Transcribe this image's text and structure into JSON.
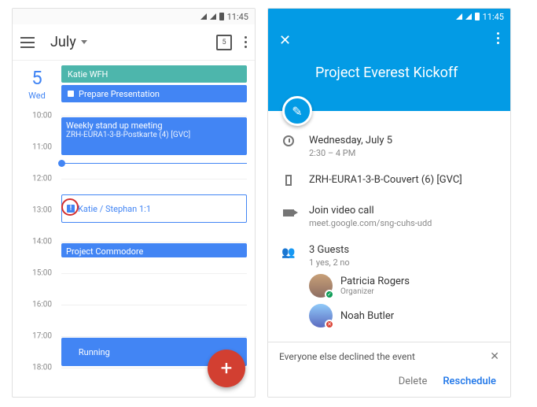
{
  "statusbar": {
    "time": "11:45"
  },
  "calendar": {
    "month": "July",
    "today_icon_num": "5",
    "day": {
      "num": "5",
      "name": "Wed"
    },
    "allday": [
      {
        "label": "Katie WFH",
        "color": "teal"
      },
      {
        "label": "Prepare Presentation",
        "color": "blue"
      }
    ],
    "hours": [
      "10:00",
      "11:00",
      "12:00",
      "13:00",
      "14:00",
      "15:00",
      "16:00",
      "17:00",
      "18:00"
    ],
    "events": {
      "standup_title": "Weekly stand up meeting",
      "standup_loc": "ZRH-EURA1-3-B-Postkarte (4) [GVC]",
      "one_on_one": "Katie / Stephan 1:1",
      "commodore": "Project Commodore",
      "running": "Running"
    }
  },
  "event_detail": {
    "title": "Project Everest Kickoff",
    "date": "Wednesday, July 5",
    "time": "2:30 – 4 PM",
    "room": "ZRH-EURA1-3-B-Couvert (6) [GVC]",
    "video_label": "Join video call",
    "video_url": "meet.google.com/sng-cuhs-udd",
    "guests_count": "3 Guests",
    "guests_status": "1 yes, 2 no",
    "guests": [
      {
        "name": "Patricia Rogers",
        "role": "Organizer",
        "status": "ok"
      },
      {
        "name": "Noah Butler",
        "role": "",
        "status": "no"
      }
    ],
    "notice": "Everyone else declined the event",
    "actions": {
      "delete": "Delete",
      "reschedule": "Reschedule"
    }
  }
}
